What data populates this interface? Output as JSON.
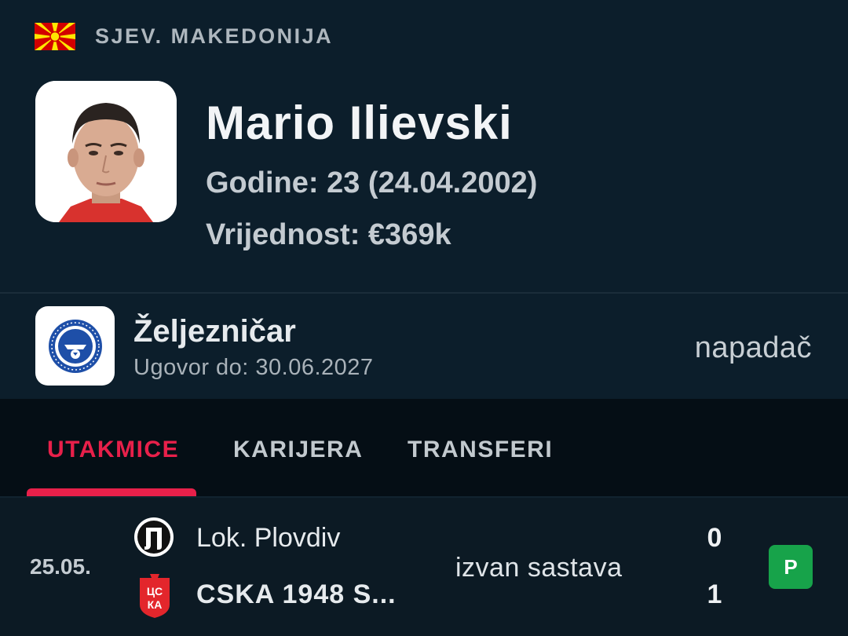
{
  "country": {
    "name": "SJEV. MAKEDONIJA",
    "flag_icon": "north-macedonia-flag-icon",
    "flag_colors": [
      "#d20000",
      "#ffe600"
    ]
  },
  "player": {
    "name": "Mario Ilievski",
    "age_line": "Godine: 23 (24.04.2002)",
    "value_line": "Vrijednost: €369k",
    "photo": "player-photo"
  },
  "club": {
    "name": "Željezničar",
    "contract": "Ugovor do: 30.06.2027",
    "position": "napadač",
    "logo": "zeljeznicar-crest-icon"
  },
  "tabs": [
    {
      "label": "UTAKMICE",
      "active": true
    },
    {
      "label": "KARIJERA",
      "active": false
    },
    {
      "label": "TRANSFERI",
      "active": false
    }
  ],
  "match": {
    "date": "25.05.",
    "home": {
      "name": "Lok. Plovdiv",
      "score": "0",
      "logo": "lok-plovdiv-crest-icon"
    },
    "away": {
      "name": "CSKA 1948 S...",
      "score": "1",
      "logo": "cska-1948-crest-icon"
    },
    "status": "izvan sastava",
    "result": "P",
    "result_color": "#17a34a"
  },
  "colors": {
    "accent": "#e8204a",
    "background": "#0c1a24"
  }
}
